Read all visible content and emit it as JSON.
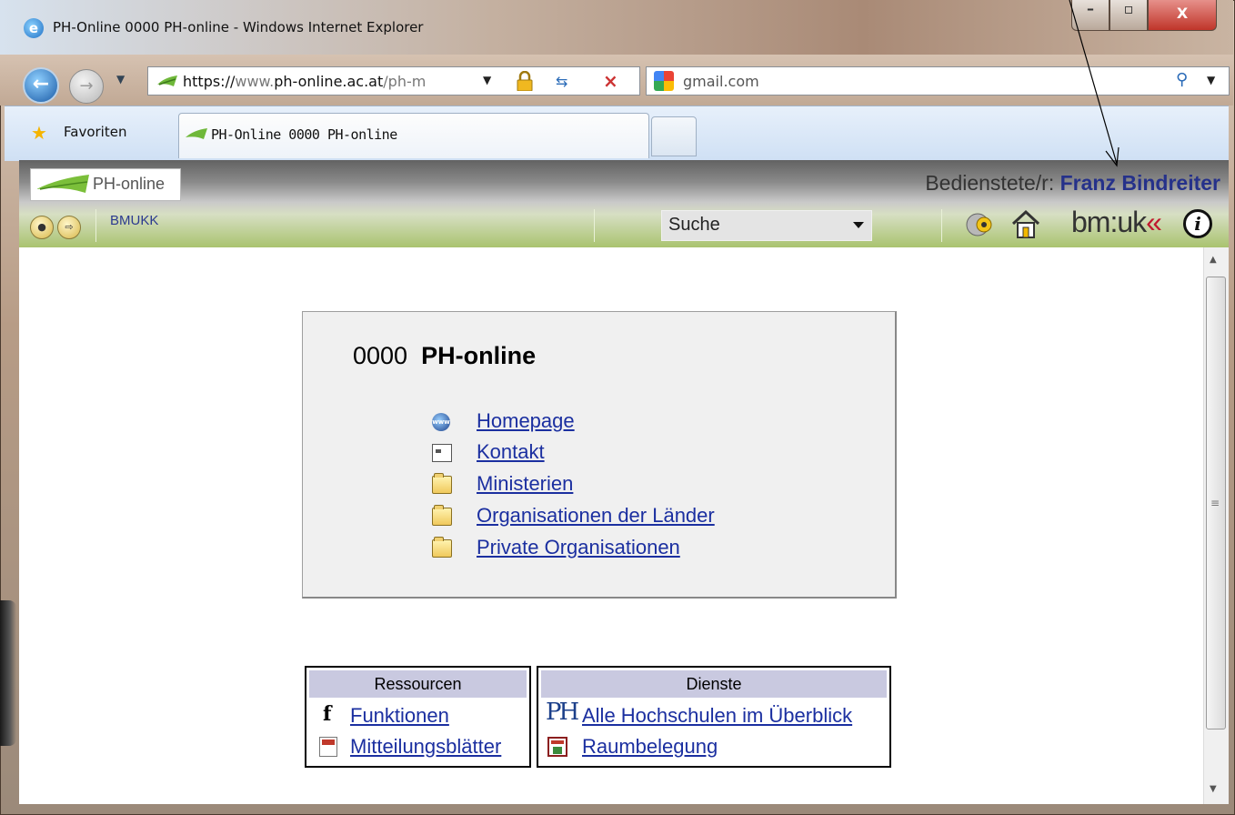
{
  "window": {
    "title": "PH-Online 0000 PH-online - Windows Internet Explorer",
    "controls": {
      "minimize": "–",
      "maximize": "▫",
      "close": "X"
    }
  },
  "browser": {
    "address_scheme": "https://",
    "address_host_prefix": "www.",
    "address_host": "ph-online.ac.at",
    "address_path": "/ph-m",
    "search_text": "gmail.com",
    "favorites_label": "Favoriten",
    "tab_label": "PH-Online 0000 PH-online"
  },
  "header": {
    "logo_text": "PH-online",
    "user_role": "Bedienstete/r:",
    "user_name": "Franz Bindreiter",
    "org_link": "BMUKK",
    "search_select": "Suche",
    "bmuk_logo_main": "bm:uk",
    "bmuk_logo_accent": "«"
  },
  "main": {
    "title_number": "0000",
    "title_name": "PH-online",
    "links": [
      {
        "label": "Homepage",
        "icon": "www-globe-icon"
      },
      {
        "label": "Kontakt",
        "icon": "contact-card-icon"
      },
      {
        "label": "Ministerien",
        "icon": "folder-icon"
      },
      {
        "label": "Organisationen der Länder",
        "icon": "folder-icon"
      },
      {
        "label": "Private Organisationen",
        "icon": "folder-icon"
      }
    ]
  },
  "ressourcen": {
    "header": "Ressourcen",
    "items": [
      {
        "label": "Funktionen",
        "icon": "function-f-icon"
      },
      {
        "label": "Mitteilungsblätter",
        "icon": "document-icon"
      }
    ]
  },
  "dienste": {
    "header": "Dienste",
    "items": [
      {
        "label": "Alle Hochschulen im Überblick",
        "icon": "ph-logo-icon"
      },
      {
        "label": "Raumbelegung",
        "icon": "calendar-icon"
      }
    ]
  },
  "colors": {
    "link": "#1b2fa0",
    "user_name": "#25318a",
    "header_green": "#a9c36f",
    "table_header": "#c9c9e0"
  }
}
